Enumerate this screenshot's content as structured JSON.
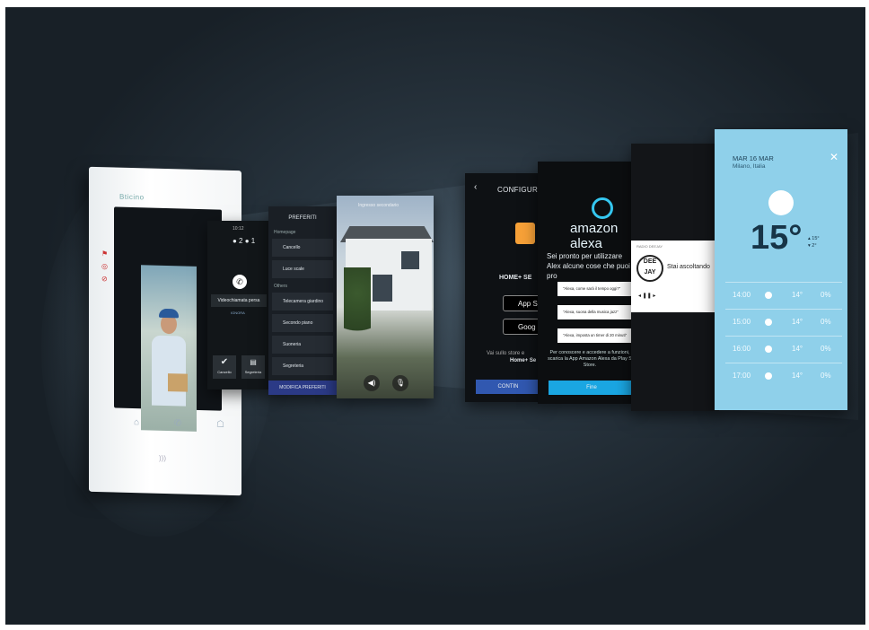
{
  "device": {
    "brand": "Bticino"
  },
  "call_panel": {
    "time": "10:12",
    "status_icons": "● 2 ● 1",
    "call_label": "Videochiamata persa",
    "ignore": "IGNORA",
    "btn1": "Cancello",
    "btn2": "Segreteria"
  },
  "favorites_panel": {
    "title": "PREFERITI",
    "section1": "Homepage",
    "section2": "Others",
    "items": [
      "Cancello",
      "Luce scale",
      "Telecamera giardino",
      "Secondo piano",
      "Suoneria",
      "Segreteria"
    ],
    "edit": "MODIFICA PREFERITI"
  },
  "camera_panel": {
    "caption": "Ingresso secondario"
  },
  "config_panel": {
    "title": "CONFIGURA",
    "home": "HOME+ SE",
    "appstore": "App S",
    "google": "Goog",
    "text1": "Vai sullo store e",
    "text2": "Home+ Se",
    "continue": "CONTIN"
  },
  "alexa_panel": {
    "brand": "amazon alexa",
    "intro": "Sei pronto per utilizzare Alex alcune cose che puoi pro",
    "bubbles": [
      "\"Alexa, come sarà il tempo oggi?\"",
      "\"Alexa, suona della musica jazz\"",
      "\"Alexa, imposta un timer di 20 minuti\""
    ],
    "info": "Per conoscere e accedere a funzioni, scarica la App Amazon Alexa da Play S Store.",
    "fine": "Fine"
  },
  "radio_panel": {
    "label": "RADIO DEEJAY",
    "logo": "DEE JAY",
    "playing": "Stai ascoltando",
    "controls": "◂   ❚❚   ▸"
  },
  "weather_panel": {
    "date": "MAR 16 MAR",
    "city": "Milano, Italia",
    "temp": "15°",
    "high": "15°",
    "low": "2°",
    "rows": [
      {
        "time": "14:00",
        "temp": "14°",
        "pct": "0%"
      },
      {
        "time": "15:00",
        "temp": "14°",
        "pct": "0%"
      },
      {
        "time": "16:00",
        "temp": "14°",
        "pct": "0%"
      },
      {
        "time": "17:00",
        "temp": "14°",
        "pct": "0%"
      }
    ]
  }
}
